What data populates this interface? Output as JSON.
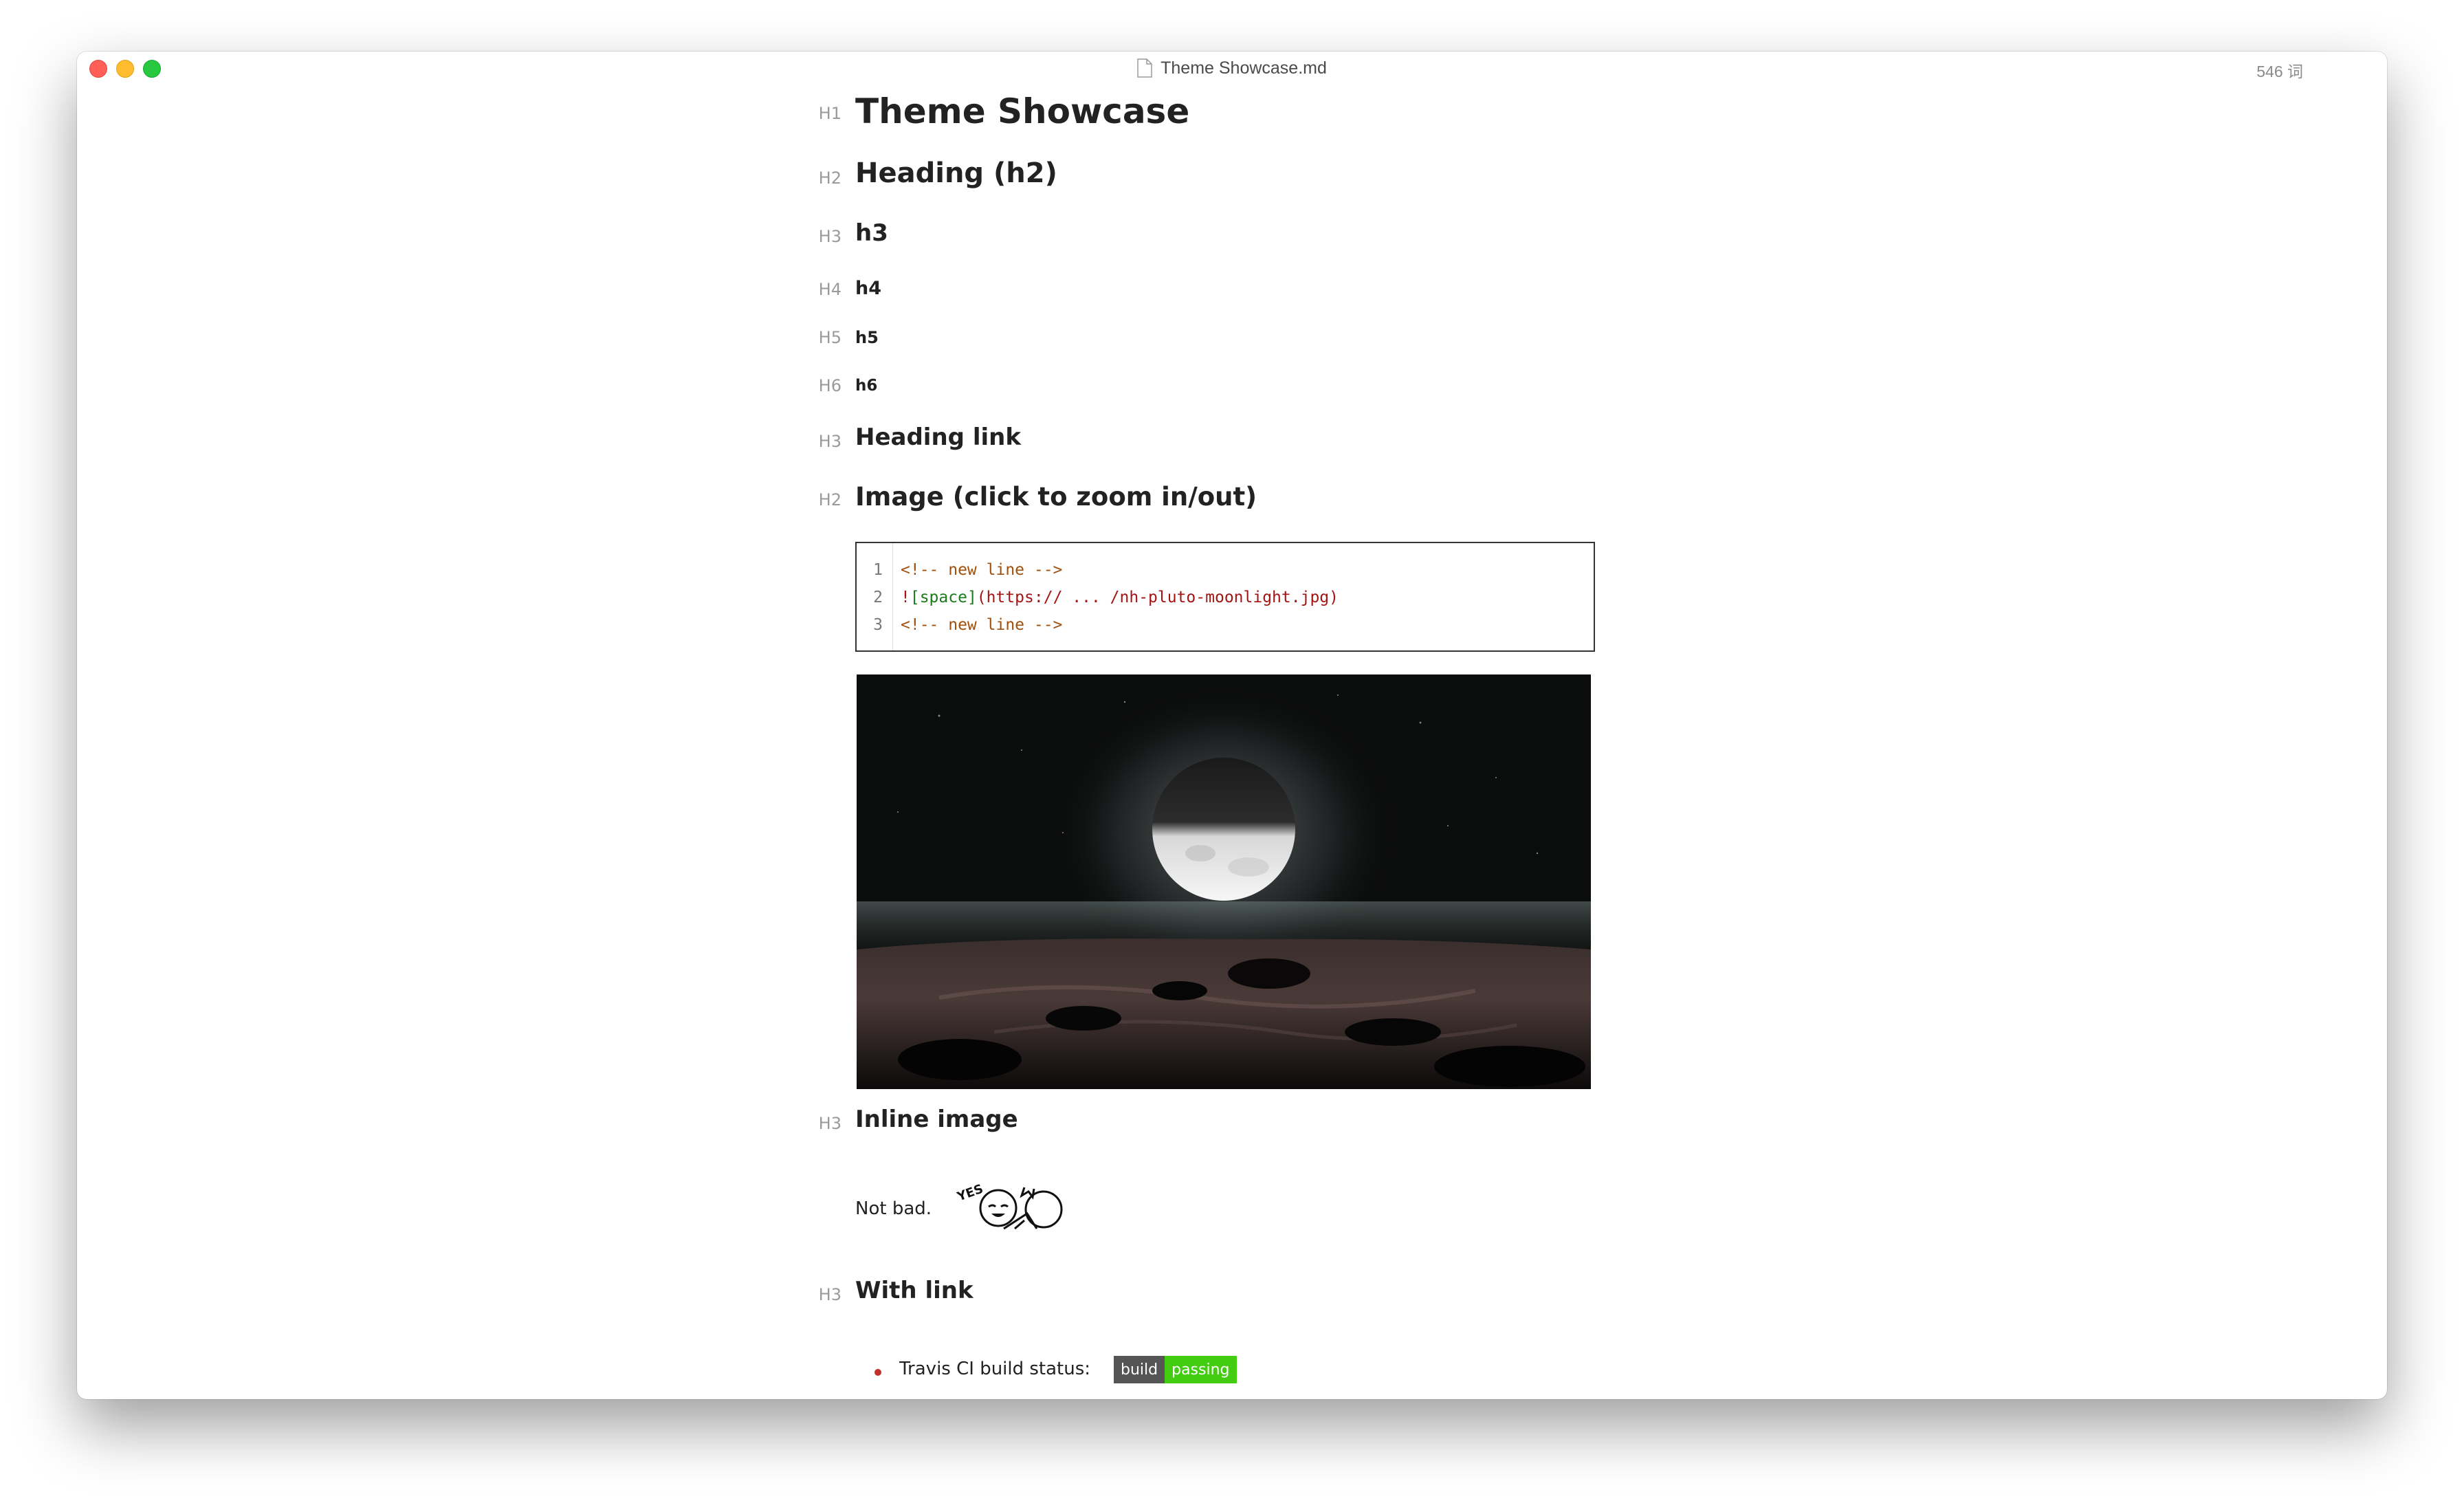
{
  "window": {
    "title": "Theme Showcase.md",
    "word_count": "546 词"
  },
  "headings": [
    {
      "tag": "H1",
      "text": "Theme Showcase"
    },
    {
      "tag": "H2",
      "text": "Heading (h2)"
    },
    {
      "tag": "H3",
      "text": "h3"
    },
    {
      "tag": "H4",
      "text": "h4"
    },
    {
      "tag": "H5",
      "text": "h5"
    },
    {
      "tag": "H6",
      "text": "h6"
    },
    {
      "tag": "H3",
      "text": "Heading link"
    },
    {
      "tag": "H2",
      "text": "Image (click to zoom in/out)"
    },
    {
      "tag": "H3",
      "text": "Inline image"
    },
    {
      "tag": "H3",
      "text": "With link"
    }
  ],
  "code_block": {
    "line_numbers": [
      "1",
      "2",
      "3"
    ],
    "line1": "<!-- new line -->",
    "line2_bang": "!",
    "line2_alt": "[space]",
    "line2_url": "(https:// ... /nh-pluto-moonlight.jpg)",
    "line3": "<!-- new line -->"
  },
  "inline_image": {
    "text": "Not bad.",
    "sticker_text": "YES"
  },
  "list": {
    "item1": "Travis CI build status:"
  },
  "badge": {
    "left": "build",
    "right": "passing",
    "left_color": "#555555",
    "right_color": "#44cc11"
  },
  "colors": {
    "bullet": "#c0312b",
    "heading": "#222222",
    "tag": "#9a9a9a"
  }
}
